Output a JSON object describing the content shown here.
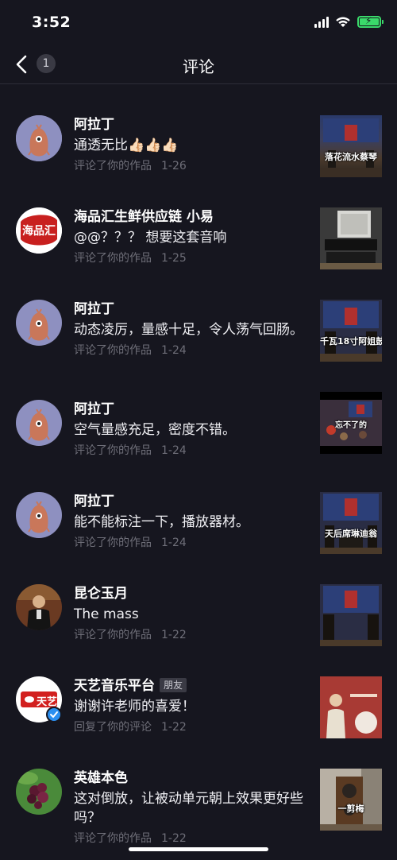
{
  "status": {
    "time": "3:52"
  },
  "header": {
    "title": "评论",
    "back_badge": "1"
  },
  "comments": [
    {
      "name": "阿拉丁",
      "text": "通透无比👍🏻👍🏻👍🏻",
      "action": "评论了你的作品",
      "date": "1-26",
      "thumb_caption": "落花流水蔡琴",
      "avatar": "creature"
    },
    {
      "name": "海品汇生鲜供应链 小易",
      "text": "@@？？？ 想要这套音响",
      "action": "评论了你的作品",
      "date": "1-25",
      "thumb_caption": "",
      "avatar": "logo",
      "avatar_text": "海品汇"
    },
    {
      "name": "阿拉丁",
      "text": "动态凌厉，量感十足，令人荡气回肠。",
      "action": "评论了你的作品",
      "date": "1-24",
      "thumb_caption": "千瓦18寸阿姐鼓",
      "avatar": "creature"
    },
    {
      "name": "阿拉丁",
      "text": "空气量感充足，密度不错。",
      "action": "评论了你的作品",
      "date": "1-24",
      "thumb_caption": "忘不了的",
      "avatar": "creature"
    },
    {
      "name": "阿拉丁",
      "text": "能不能标注一下，播放器材。",
      "action": "评论了你的作品",
      "date": "1-24",
      "thumb_caption": "天后席琳迪翁",
      "avatar": "creature"
    },
    {
      "name": "昆仑玉月",
      "text": "The mass",
      "action": "评论了你的作品",
      "date": "1-22",
      "thumb_caption": "",
      "avatar": "person"
    },
    {
      "name": "天艺音乐平台",
      "friend_tag": "朋友",
      "text": "谢谢许老师的喜爱！",
      "action": "回复了你的评论",
      "date": "1-22",
      "thumb_caption": "",
      "avatar": "tianyi",
      "avatar_text": "天艺"
    },
    {
      "name": "英雄本色",
      "text": "这对倒放，让被动单元朝上效果更好些吗？",
      "action": "评论了你的作品",
      "date": "1-22",
      "thumb_caption": "一剪梅",
      "avatar": "berries"
    }
  ],
  "colors": {
    "background": "#16161f",
    "meta_text": "#6e6e78",
    "battery": "#3ad96a"
  }
}
